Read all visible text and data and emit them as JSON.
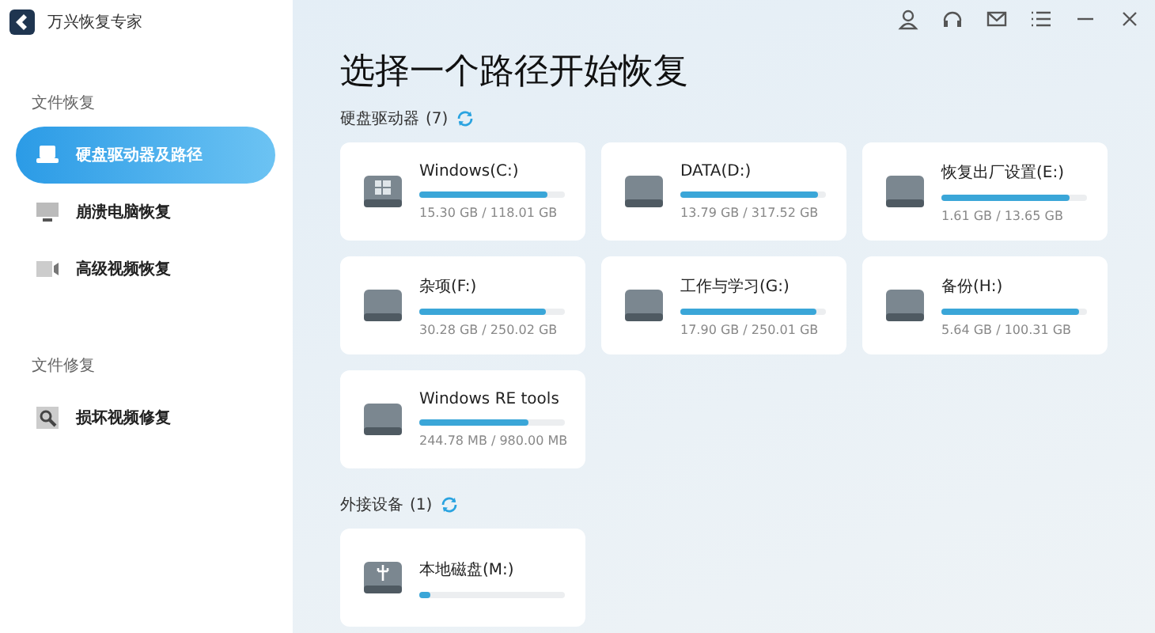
{
  "app": {
    "title": "万兴恢复专家"
  },
  "sidebar": {
    "sections": [
      {
        "heading": "文件恢复",
        "items": [
          {
            "label": "硬盘驱动器及路径",
            "kind": "drive",
            "selected": true
          },
          {
            "label": "崩溃电脑恢复",
            "kind": "monitor",
            "selected": false
          },
          {
            "label": "高级视频恢复",
            "kind": "video",
            "selected": false
          }
        ]
      },
      {
        "heading": "文件修复",
        "items": [
          {
            "label": "损坏视频修复",
            "kind": "repair",
            "selected": false
          }
        ]
      }
    ]
  },
  "main": {
    "title": "选择一个路径开始恢复",
    "groups": [
      {
        "label": "硬盘驱动器",
        "count": "(7)",
        "drives": [
          {
            "name": "Windows(C:)",
            "kind": "windows",
            "level": 0.88,
            "size": "15.30 GB / 118.01 GB"
          },
          {
            "name": "DATA(D:)",
            "kind": "disk",
            "level": 0.95,
            "size": "13.79 GB / 317.52 GB"
          },
          {
            "name": "恢复出厂设置(E:)",
            "kind": "disk",
            "level": 0.88,
            "size": "1.61 GB / 13.65 GB"
          },
          {
            "name": "杂项(F:)",
            "kind": "disk",
            "level": 0.87,
            "size": "30.28 GB / 250.02 GB"
          },
          {
            "name": "工作与学习(G:)",
            "kind": "disk",
            "level": 0.93,
            "size": "17.90 GB / 250.01 GB"
          },
          {
            "name": "备份(H:)",
            "kind": "disk",
            "level": 0.95,
            "size": "5.64 GB / 100.31 GB"
          },
          {
            "name": "Windows RE tools",
            "kind": "disk",
            "level": 0.75,
            "size": "244.78 MB / 980.00 MB"
          }
        ]
      },
      {
        "label": "外接设备",
        "count": "(1)",
        "drives": [
          {
            "name": "本地磁盘(M:)",
            "kind": "usb",
            "level": 0.08
          }
        ]
      }
    ]
  }
}
